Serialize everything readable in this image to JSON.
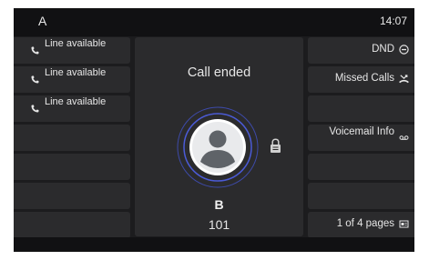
{
  "status_bar": {
    "title": "A",
    "time": "14:07"
  },
  "line_keys": [
    {
      "label": "Line available",
      "icon": "phone-icon"
    },
    {
      "label": "Line available",
      "icon": "phone-icon"
    },
    {
      "label": "Line available",
      "icon": "phone-icon"
    }
  ],
  "call": {
    "status": "Call ended",
    "name": "B",
    "number": "101"
  },
  "softkeys": {
    "dnd": {
      "label": "DND",
      "icon": "minus-circle-icon"
    },
    "missed": {
      "label": "Missed Calls",
      "icon": "missed-call-icon"
    },
    "voicemail": {
      "label": "Voicemail Info",
      "icon": "voicemail-icon"
    },
    "pages": {
      "label": "1 of 4 pages",
      "icon": "page-icon"
    }
  },
  "colors": {
    "screen_bg": "#1c1c1e",
    "key_bg": "#2b2b2d",
    "status_bg": "#111113",
    "avatar_ring": "#4b5bd6"
  }
}
